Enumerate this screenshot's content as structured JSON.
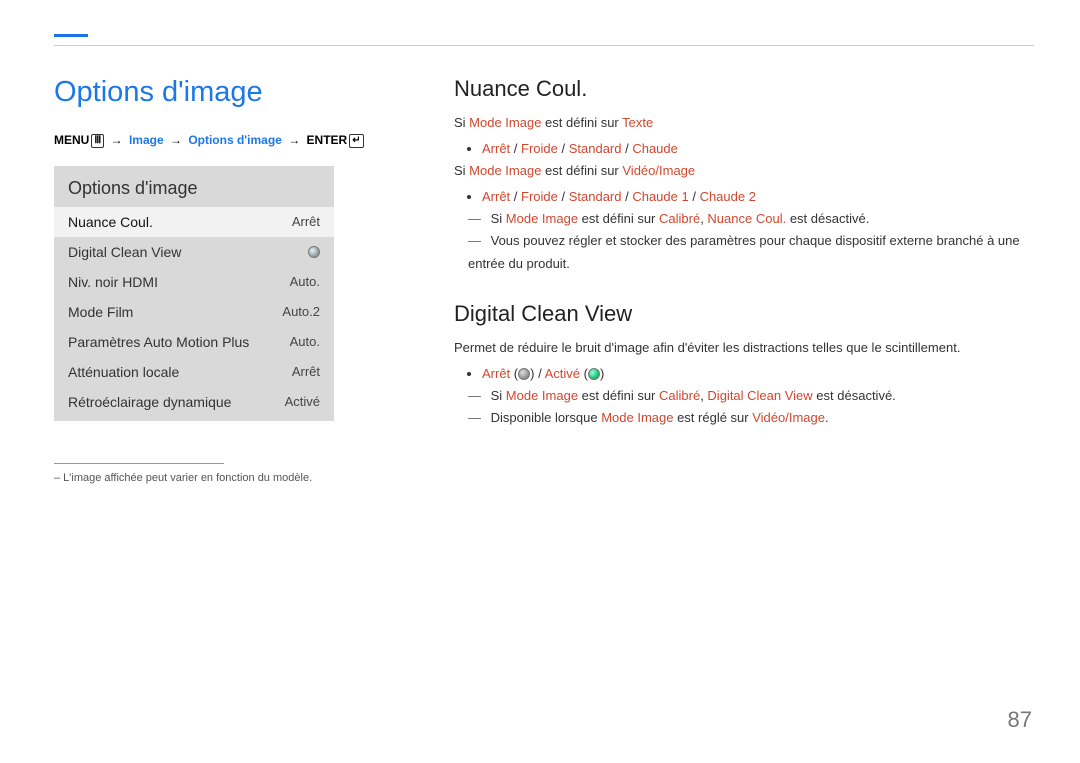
{
  "page_title": "Options d'image",
  "breadcrumb": {
    "menu": "MENU",
    "image": "Image",
    "options": "Options d'image",
    "enter": "ENTER"
  },
  "menu_panel": {
    "title": "Options d'image",
    "rows": [
      {
        "label": "Nuance Coul.",
        "value": "Arrêt"
      },
      {
        "label": "Digital Clean View",
        "value": ""
      },
      {
        "label": "Niv. noir HDMI",
        "value": "Auto."
      },
      {
        "label": "Mode Film",
        "value": "Auto.2"
      },
      {
        "label": "Paramètres Auto Motion Plus",
        "value": "Auto."
      },
      {
        "label": "Atténuation locale",
        "value": "Arrêt"
      },
      {
        "label": "Rétroéclairage dynamique",
        "value": "Activé"
      }
    ]
  },
  "footnote": "– L'image affichée peut varier en fonction du modèle.",
  "right": {
    "nuance": {
      "title": "Nuance Coul.",
      "line1_a": "Si ",
      "line1_b": "Mode Image",
      "line1_c": " est défini sur ",
      "line1_d": "Texte",
      "bullets1": {
        "arret": "Arrêt",
        "froide": "Froide",
        "standard": "Standard",
        "chaude": "Chaude",
        "sep": " / "
      },
      "line2_a": "Si ",
      "line2_b": "Mode Image",
      "line2_c": " est défini sur ",
      "line2_d": "Vidéo/Image",
      "bullets2": {
        "arret": "Arrêt",
        "froide": "Froide",
        "standard": "Standard",
        "chaude1": "Chaude 1",
        "chaude2": "Chaude 2",
        "sep": " / "
      },
      "dash1_a": "Si ",
      "dash1_b": "Mode Image",
      "dash1_c": " est défini sur ",
      "dash1_d": "Calibré",
      "dash1_e": ", ",
      "dash1_f": "Nuance Coul.",
      "dash1_g": " est désactivé.",
      "dash2": "Vous pouvez régler et stocker des paramètres pour chaque dispositif externe branché à une entrée du produit."
    },
    "dcv": {
      "title": "Digital Clean View",
      "desc": "Permet de réduire le bruit d'image afin d'éviter les distractions telles que le scintillement.",
      "arret": "Arrêt",
      "active": "Activé",
      "paren_open": " (",
      "paren_close": ")",
      "sep": " / ",
      "dash1_a": "Si ",
      "dash1_b": "Mode Image",
      "dash1_c": " est défini sur ",
      "dash1_d": "Calibré",
      "dash1_e": ", ",
      "dash1_f": "Digital Clean View",
      "dash1_g": " est désactivé.",
      "dash2_a": "Disponible lorsque ",
      "dash2_b": "Mode Image",
      "dash2_c": " est réglé sur ",
      "dash2_d": "Vidéo/Image",
      "dash2_e": "."
    }
  },
  "page_number": "87"
}
